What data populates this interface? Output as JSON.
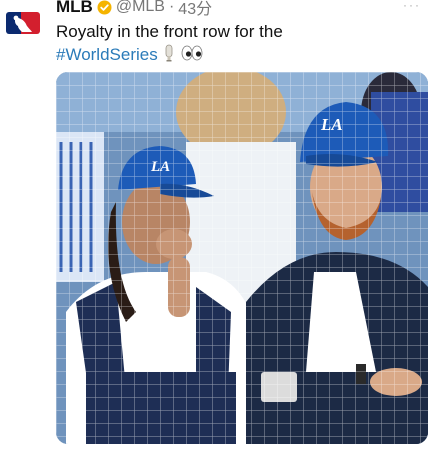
{
  "tweet": {
    "display_name": "MLB",
    "handle": "@MLB",
    "separator": "·",
    "time": "43分",
    "more_label": "···",
    "text_line1": "Royalty in the front row for the",
    "hashtag": "#WorldSeries",
    "avatar_icon": "mlb-logo-icon",
    "verified_icon": "verified-badge-icon",
    "emoji_icons": [
      "baseball-bat-icon",
      "eyes-icon"
    ]
  },
  "photo": {
    "cap_text_left": "LA",
    "cap_text_right": "LA"
  },
  "colors": {
    "hashtag": "#2b7bb9",
    "verified": "#f5b400",
    "cap_blue": "#1d5bb8"
  }
}
